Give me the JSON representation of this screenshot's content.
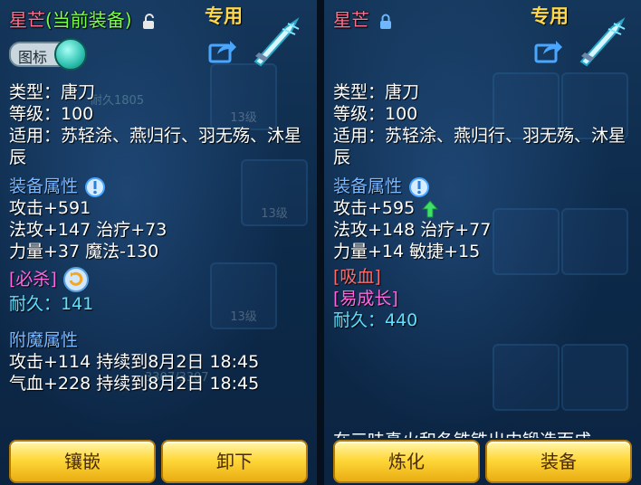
{
  "left": {
    "item_name": "星芒",
    "equipped_tag": "(当前装备)",
    "dedicated": "专用",
    "icon_toggle_label": "图标",
    "type": "类型：唐刀",
    "level": "等级：100",
    "applicable": "适用：苏轻涂、燕归行、羽无殇、沐星辰",
    "equip_attr_title": "装备属性",
    "attrs": [
      "攻击+591",
      "法攻+147 治疗+73",
      "力量+37 魔法-130"
    ],
    "special_skill": "[必杀]",
    "durability": "耐久：141",
    "enchant_title": "附魔属性",
    "enchants": [
      "攻击+114 持续到8月2日 18:45",
      "气血+228 持续到8月2日 18:45"
    ],
    "bg_texts": [
      "耐久1805",
      "13级",
      "13级",
      "13级",
      "3307/3307"
    ],
    "buttons": [
      "镶嵌",
      "卸下"
    ]
  },
  "right": {
    "item_name": "星芒",
    "dedicated": "专用",
    "type": "类型：唐刀",
    "level": "等级：100",
    "applicable": "适用：苏轻涂、燕归行、羽无殇、沐星辰",
    "equip_attr_title": "装备属性",
    "attr_attack": "攻击+595",
    "attrs": [
      "法攻+148 治疗+77",
      "力量+14 敏捷+15"
    ],
    "special_1": "[吸血]",
    "special_2": "[易成长]",
    "durability": "耐久：440",
    "cut_text": "在三味真火和冬铁铁出中锻造而成",
    "buttons": [
      "炼化",
      "装备"
    ]
  },
  "colors": {
    "name": "#ff6f8f",
    "equipped": "#7cff4a",
    "dedicated": "#ffd84a",
    "section": "#7ab8ff",
    "special": "#ff66e0",
    "lifesteal": "#ff6b6b",
    "durability": "#5fe1ff",
    "button": "#ffd83a"
  }
}
